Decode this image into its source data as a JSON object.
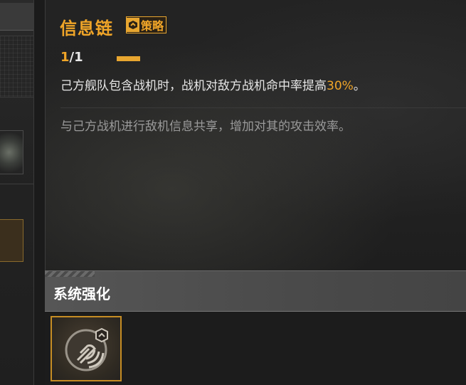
{
  "skill": {
    "title": "信息链",
    "tag_label": "策略",
    "level_current": "1",
    "level_total": "/1",
    "effect_before": "己方舰队包含战机时，战机对敌方战机命中率提高",
    "effect_value": "30%",
    "effect_after": "。",
    "flavor": "与己方战机进行敌机信息共享，增加对其的攻击效率。"
  },
  "section": {
    "title": "系统强化"
  },
  "icons": [
    "strategy-tag-icon",
    "signal-chain-icon"
  ],
  "colors": {
    "accent": "#f0a528",
    "panel_bg": "#222222",
    "header_bg": "#505050"
  }
}
